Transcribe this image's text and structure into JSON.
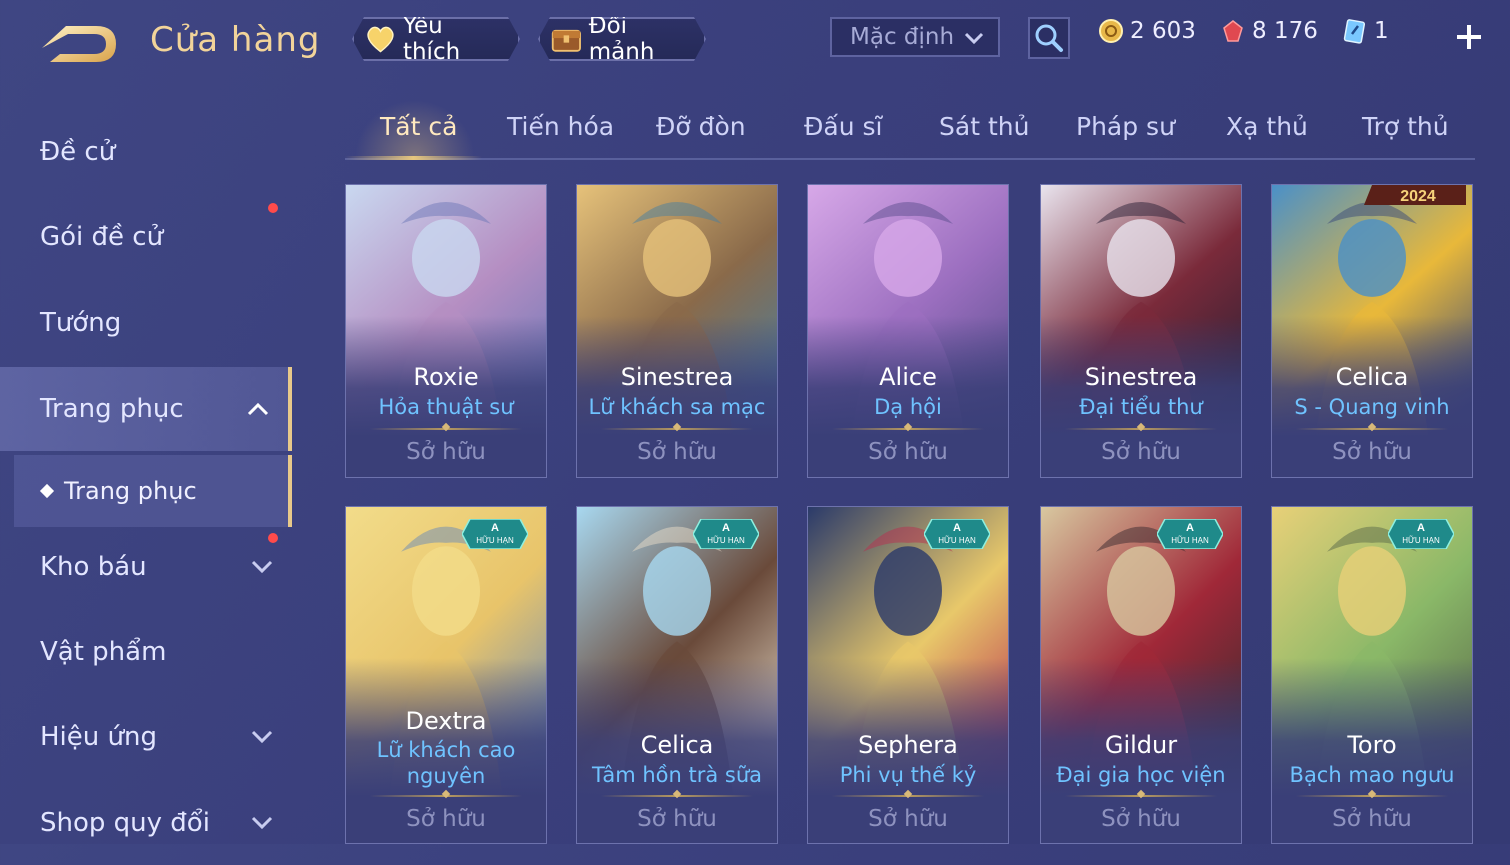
{
  "header": {
    "title": "Cửa hàng",
    "favorites_label": "Yêu thích",
    "exchange_label": "Đổi mảnh",
    "sort_value": "Mặc định",
    "gold": "2 603",
    "ruby": "8 176",
    "voucher": "1"
  },
  "sidebar": {
    "items": [
      {
        "label": "Đề cử"
      },
      {
        "label": "Gói đề cử"
      },
      {
        "label": "Tướng"
      },
      {
        "label": "Trang phục"
      },
      {
        "label": "Kho báu"
      },
      {
        "label": "Vật phẩm"
      },
      {
        "label": "Hiệu ứng"
      },
      {
        "label": "Shop quy đổi"
      }
    ],
    "sub_item": "Trang phục"
  },
  "tabs": [
    "Tất cả",
    "Tiến hóa",
    "Đỡ đòn",
    "Đấu sĩ",
    "Sát thủ",
    "Pháp sư",
    "Xạ thủ",
    "Trợ thủ"
  ],
  "badge": {
    "letter": "A",
    "text": "HỮU HẠN",
    "year": "2024"
  },
  "cards": [
    {
      "hero": "Roxie",
      "skin": "Hỏa thuật sư",
      "status": "Sở hữu",
      "colors": [
        "#c9d8f0",
        "#b58ec2",
        "#6e78b8"
      ]
    },
    {
      "hero": "Sinestrea",
      "skin": "Lữ khách sa mạc",
      "status": "Sở hữu",
      "colors": [
        "#e6c27a",
        "#8a6a4a",
        "#4a7fa0"
      ]
    },
    {
      "hero": "Alice",
      "skin": "Dạ hội",
      "status": "Sở hữu",
      "colors": [
        "#d7a8e8",
        "#9c6fc0",
        "#5b4e8e"
      ]
    },
    {
      "hero": "Sinestrea",
      "skin": "Đại tiểu thư",
      "status": "Sở hữu",
      "colors": [
        "#e9e4ee",
        "#7a2a3a",
        "#2a2035"
      ]
    },
    {
      "hero": "Celica",
      "skin": "S - Quang vinh",
      "status": "Sở hữu",
      "colors": [
        "#4a90c8",
        "#e8b83a",
        "#3a4a7a"
      ]
    },
    {
      "hero": "Dextra",
      "skin": "Lữ khách cao nguyên",
      "status": "Sở hữu",
      "colors": [
        "#f2dc8a",
        "#e8c46a",
        "#6a8ab8"
      ]
    },
    {
      "hero": "Celica",
      "skin": "Tâm hồn trà sữa",
      "status": "Sở hữu",
      "colors": [
        "#a8d8f0",
        "#6a4a3a",
        "#e8dcc8"
      ]
    },
    {
      "hero": "Sephera",
      "skin": "Phi vụ thế kỷ",
      "status": "Sở hữu",
      "colors": [
        "#2a3a6a",
        "#e8c86a",
        "#b83050"
      ]
    },
    {
      "hero": "Gildur",
      "skin": "Đại gia học viện",
      "status": "Sở hữu",
      "colors": [
        "#d8c8a0",
        "#a02838",
        "#3a2a30"
      ]
    },
    {
      "hero": "Toro",
      "skin": "Bạch mao ngưu",
      "status": "Sở hữu",
      "colors": [
        "#e8d078",
        "#8ab868",
        "#5a6a4a"
      ]
    }
  ]
}
